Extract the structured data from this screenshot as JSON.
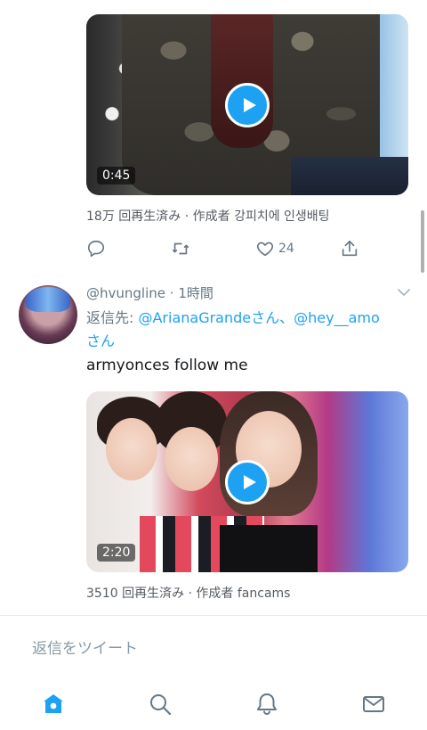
{
  "tweet1": {
    "video_duration": "0:45",
    "meta": "18万 回再生済み · 作成者 강피치에 인생배팅",
    "actions": {
      "reply_count": "",
      "retweet_count": "",
      "like_count": "24",
      "share_count": ""
    }
  },
  "tweet2": {
    "handle": "@hvungline",
    "time": "1時間",
    "reply_prefix": "返信先: ",
    "mention1": "@ArianaGrande",
    "joiner": "さん、",
    "mention2": "@hey__amo",
    "suffix": "さん",
    "text": "armyonces follow me",
    "video_duration": "2:20",
    "meta": "3510 回再生済み · 作成者 fancams"
  },
  "reply_bar": {
    "placeholder": "返信をツイート"
  },
  "nav": {
    "items": [
      "home-icon",
      "search-icon",
      "notifications-icon",
      "messages-icon"
    ],
    "active": "home-icon"
  },
  "colors": {
    "accent": "#1da1f2",
    "muted_text": "#657786",
    "primary_text": "#14171a"
  }
}
